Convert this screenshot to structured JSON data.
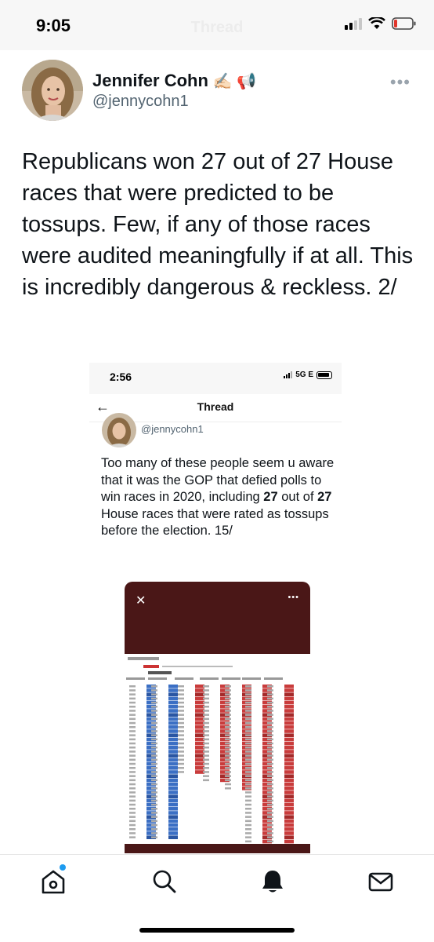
{
  "status_bar": {
    "time": "9:05",
    "faded_title": "Thread"
  },
  "tweet": {
    "display_name": "Jennifer Cohn",
    "name_emojis": "✍🏻 📢",
    "handle": "@jennycohn1",
    "text": "Republicans won 27 out of 27 House races that were predicted to be tossups. Few, if any of those races were audited meaningfully if at all. This is incredibly dangerous & reckless. 2/"
  },
  "embedded_screenshot": {
    "status_time": "2:56",
    "network": "5G E",
    "header_title": "Thread",
    "handle": "@jennycohn1",
    "text_part1": "Too many of these people seem u aware that it was the GOP that defied polls to win races in 2020, including ",
    "number_a": "27",
    "text_part2": " out of ",
    "number_b": "27",
    "text_part3": " House races that were rated as tossups before the election. 15/",
    "media": {
      "close_icon": "close-icon",
      "more_icon": "more-horizontal-icon"
    }
  },
  "bottom_nav": {
    "items": [
      "home-icon",
      "search-icon",
      "notifications-bell-icon",
      "messages-envelope-icon"
    ]
  },
  "colors": {
    "media_background": "#4a1717",
    "democrat_blue": "#3b6fc4",
    "republican_red": "#c93c3c",
    "accent_blue": "#1d9bf0"
  }
}
